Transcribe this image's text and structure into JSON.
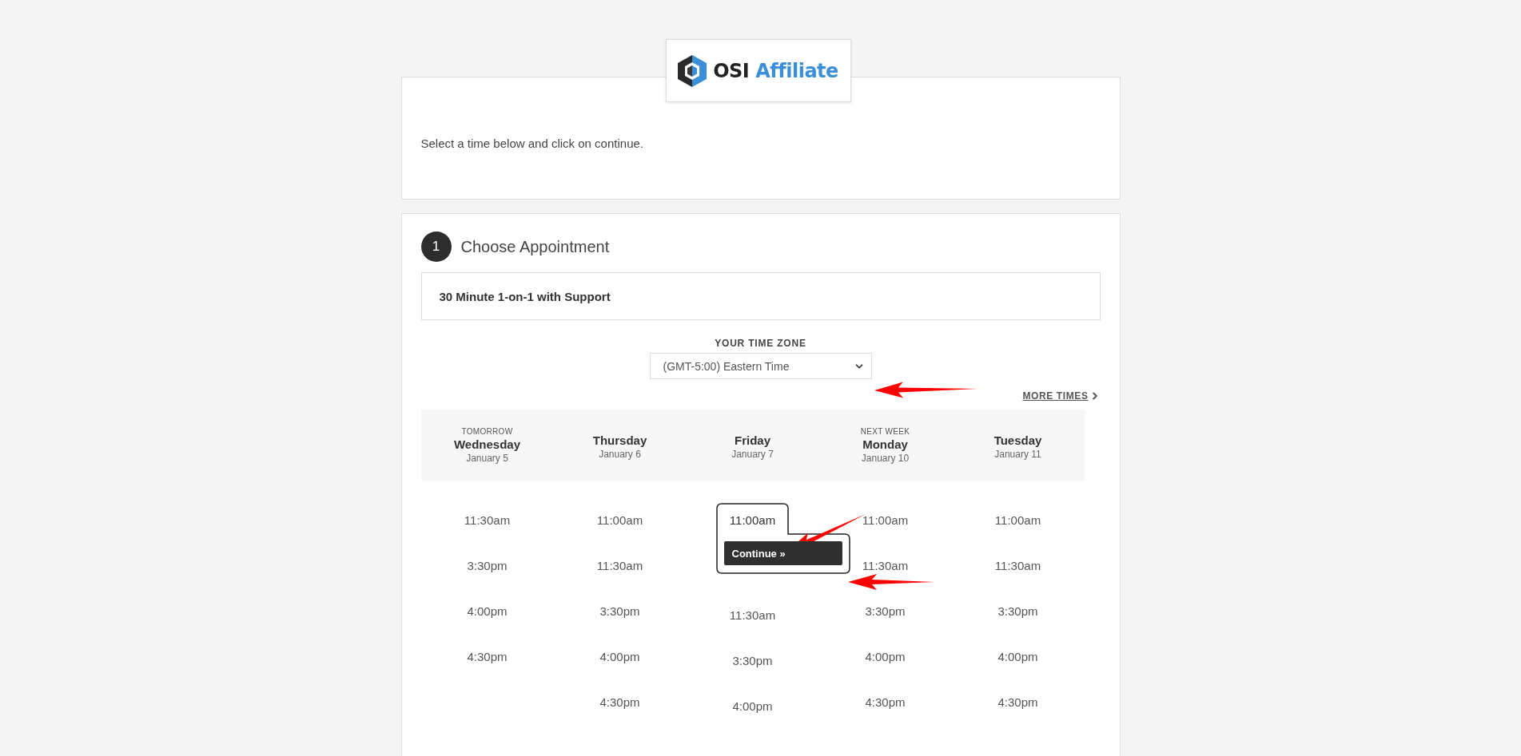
{
  "logo": {
    "name": "OSI",
    "suffix": "Affiliate"
  },
  "intro": "Select a time below and click on continue.",
  "step": {
    "number": "1",
    "title": "Choose Appointment"
  },
  "appointment_type": "30 Minute 1-on-1 with Support",
  "time_zone": {
    "label": "YOUR TIME ZONE",
    "value": "(GMT-5:00) Eastern Time"
  },
  "more_times": "MORE TIMES",
  "continue_button": "Continue »",
  "days": [
    {
      "note": "TOMORROW",
      "name": "Wednesday",
      "date": "January 5",
      "slots": [
        {
          "time": "11:30am",
          "selected": false
        },
        {
          "time": "3:30pm",
          "selected": false
        },
        {
          "time": "4:00pm",
          "selected": false
        },
        {
          "time": "4:30pm",
          "selected": false
        }
      ]
    },
    {
      "name": "Thursday",
      "date": "January 6",
      "slots": [
        {
          "time": "11:00am",
          "selected": false
        },
        {
          "time": "11:30am",
          "selected": false
        },
        {
          "time": "3:30pm",
          "selected": false
        },
        {
          "time": "4:00pm",
          "selected": false
        },
        {
          "time": "4:30pm",
          "selected": false
        }
      ]
    },
    {
      "name": "Friday",
      "date": "January 7",
      "slots": [
        {
          "time": "11:00am",
          "selected": true
        },
        {
          "time": "11:30am",
          "selected": false
        },
        {
          "time": "3:30pm",
          "selected": false
        },
        {
          "time": "4:00pm",
          "selected": false
        }
      ]
    },
    {
      "note": "NEXT WEEK",
      "name": "Monday",
      "date": "January 10",
      "slots": [
        {
          "time": "11:00am",
          "selected": false
        },
        {
          "time": "11:30am",
          "selected": false
        },
        {
          "time": "3:30pm",
          "selected": false
        },
        {
          "time": "4:00pm",
          "selected": false
        },
        {
          "time": "4:30pm",
          "selected": false
        }
      ]
    },
    {
      "name": "Tuesday",
      "date": "January 11",
      "slots": [
        {
          "time": "11:00am",
          "selected": false
        },
        {
          "time": "11:30am",
          "selected": false
        },
        {
          "time": "3:30pm",
          "selected": false
        },
        {
          "time": "4:00pm",
          "selected": false
        },
        {
          "time": "4:30pm",
          "selected": false
        }
      ]
    }
  ]
}
